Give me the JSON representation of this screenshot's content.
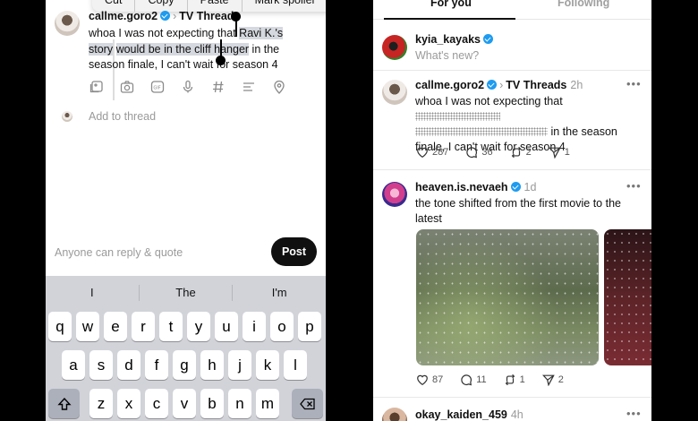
{
  "compose": {
    "context_menu": [
      "Cut",
      "Copy",
      "Paste",
      "Mark spoiler"
    ],
    "username": "callme.goro2",
    "topic": "TV Threads",
    "text_before": "whoa I was not expecting that ",
    "text_selected_1": "Ravi K.'s story",
    "text_selected_2": "would be in the cliff hanger",
    "text_after": " in the season finale, I can't wait for season 4",
    "add_thread": "Add to thread",
    "reply_option": "Anyone can reply & quote",
    "post_label": "Post"
  },
  "keyboard": {
    "suggestions": [
      "I",
      "The",
      "I'm"
    ],
    "row1": [
      "q",
      "w",
      "e",
      "r",
      "t",
      "y",
      "u",
      "i",
      "o",
      "p"
    ],
    "row2": [
      "a",
      "s",
      "d",
      "f",
      "g",
      "h",
      "j",
      "k",
      "l"
    ],
    "row3": [
      "z",
      "x",
      "c",
      "v",
      "b",
      "n",
      "m"
    ]
  },
  "feed": {
    "tabs": [
      "For you",
      "Following"
    ],
    "composer": {
      "username": "kyia_kayaks",
      "placeholder": "What's new?"
    },
    "posts": [
      {
        "username": "callme.goro2",
        "topic": "TV Threads",
        "time": "2h",
        "text_start": "whoa I was not expecting that",
        "text_mid": "in the season",
        "text_end": "finale, I can't wait for season 4",
        "likes": "287",
        "replies": "36",
        "reposts": "2",
        "shares": "1"
      },
      {
        "username": "heaven.is.nevaeh",
        "time": "1d",
        "text": "the tone shifted from the first movie to the latest",
        "likes": "87",
        "replies": "11",
        "reposts": "1",
        "shares": "2"
      },
      {
        "username": "okay_kaiden_459",
        "time": "4h"
      }
    ]
  },
  "colors": {
    "verified": "#1d9bf0",
    "post_button": "#101010"
  }
}
